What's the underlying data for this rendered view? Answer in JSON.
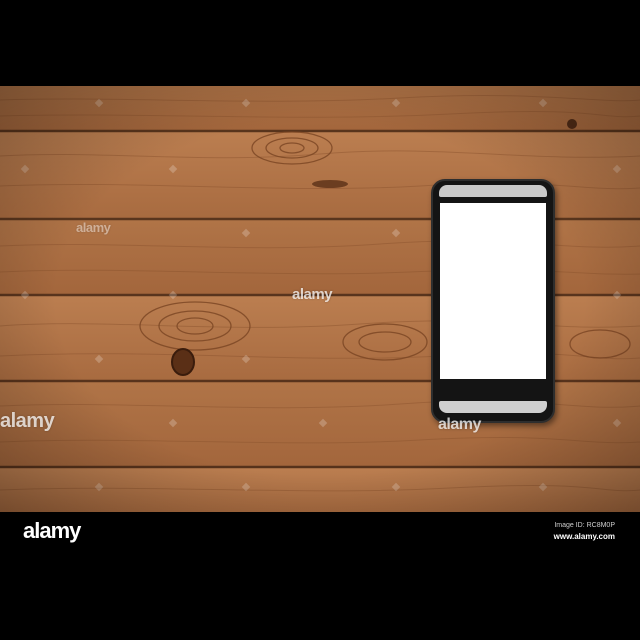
{
  "watermark": {
    "text": "alamy"
  },
  "footer": {
    "logo_text": "alamy",
    "image_id": "Image ID: RC8M0P",
    "url": "www.alamy.com"
  },
  "colors": {
    "wood_light": "#b4774a",
    "wood_dark": "#9c5f37",
    "phone_body": "#141414",
    "phone_screen": "#ffffff",
    "letterbox": "#000000"
  },
  "icons": [
    "smartphone-icon"
  ]
}
